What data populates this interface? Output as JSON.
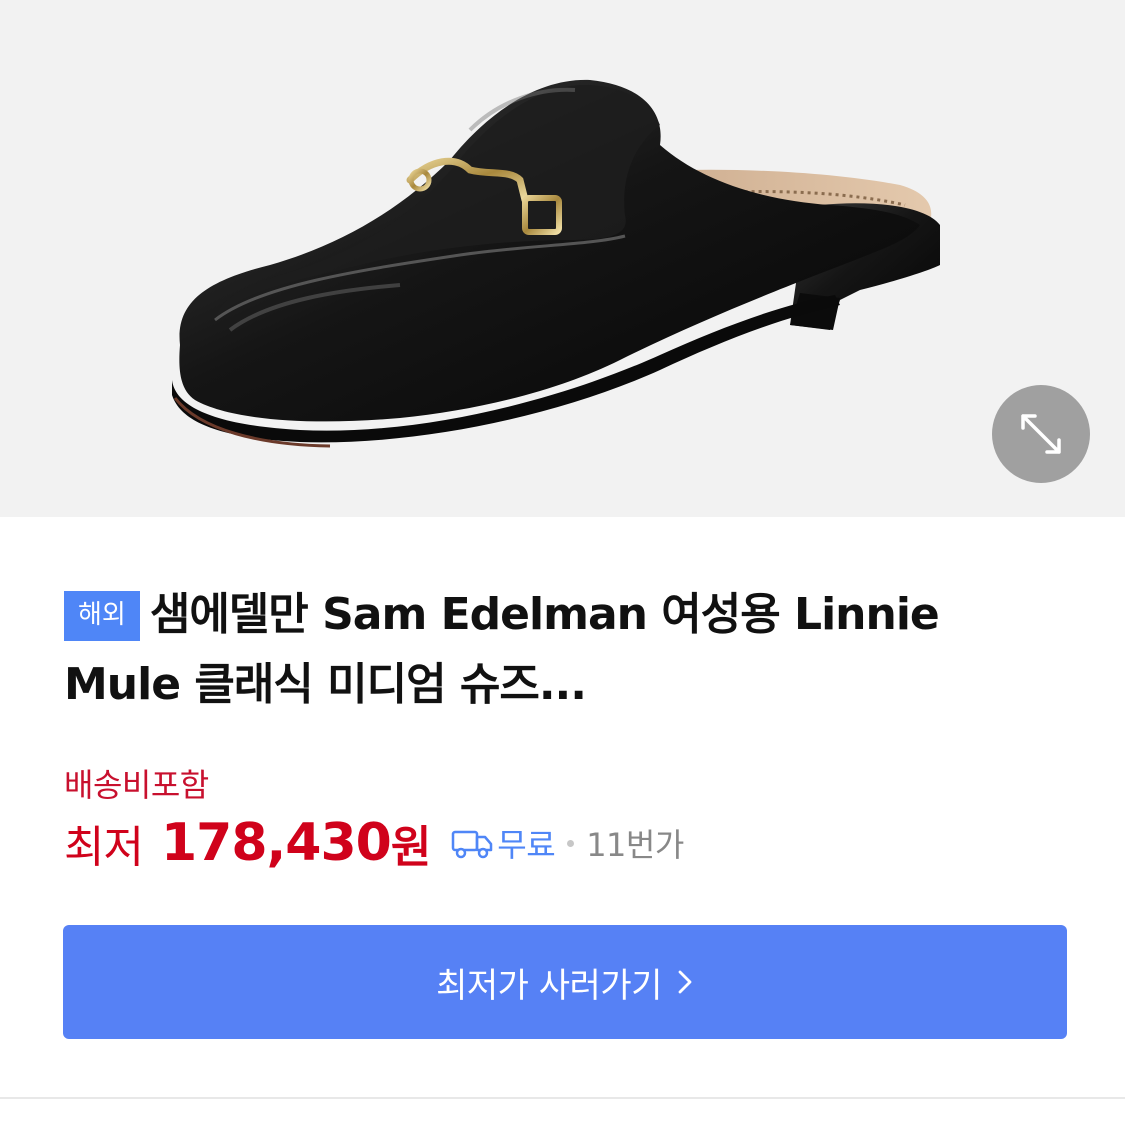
{
  "product": {
    "badge": "해외",
    "title": "샘에델만 Sam Edelman 여성용 Linnie Mule 클래식 미디엄 슈즈...",
    "image_alt": "black leather mule shoe"
  },
  "zoom": {
    "icon": "expand-arrows-icon"
  },
  "pricing": {
    "shipping_note": "배송비포함",
    "prefix": "최저",
    "value": "178,430",
    "unit": "원",
    "delivery_icon": "truck-icon",
    "delivery": "무료",
    "seller": "11번가"
  },
  "cta": {
    "label": "최저가 사러가기",
    "icon": "chevron-right-icon"
  },
  "colors": {
    "accent_blue": "#5681f5",
    "price_red": "#d0021b",
    "badge_blue": "#4f86f7"
  }
}
